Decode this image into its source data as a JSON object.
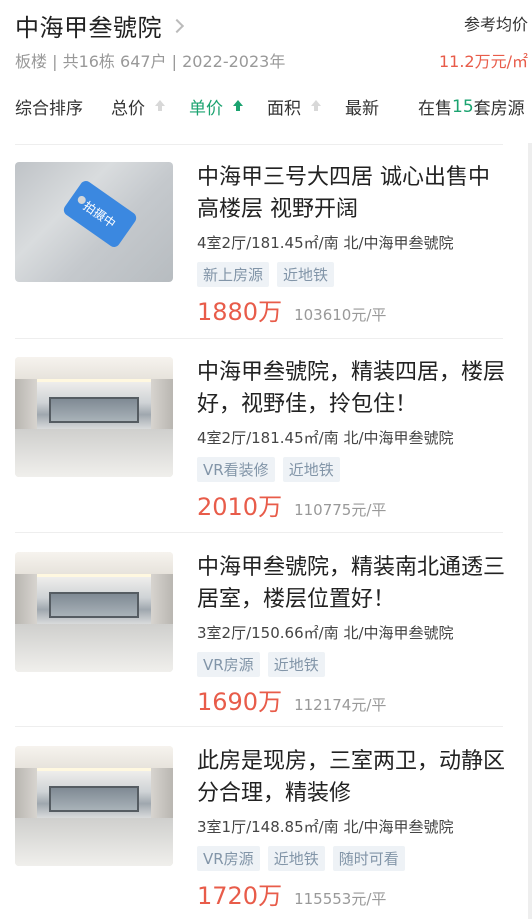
{
  "header": {
    "title": "中海甲叁號院",
    "meta": "板楼 | 共16栋 647户 | 2022-2023年",
    "price_label": "参考均价",
    "price_value": "11.2万元/㎡"
  },
  "sort": {
    "items": [
      "综合排序",
      "总价",
      "单价",
      "面积",
      "最新"
    ],
    "on_sale_prefix": "在售",
    "on_sale_count": "15",
    "on_sale_suffix": "套房源",
    "accent_color": "#1ba370"
  },
  "listings": [
    {
      "title": "中海甲三号大四居 诚心出售中高楼层 视野开阔",
      "info": "4室2厅/181.45㎡/南 北/中海甲叁號院",
      "tags": [
        "新上房源",
        "近地铁"
      ],
      "total": "1880万",
      "unit_price": "103610元/平",
      "image_badge": "拍摄中"
    },
    {
      "title": "中海甲叁號院，精装四居，楼层好，视野佳，拎包住！",
      "info": "4室2厅/181.45㎡/南 北/中海甲叁號院",
      "tags": [
        "VR看装修",
        "近地铁"
      ],
      "total": "2010万",
      "unit_price": "110775元/平"
    },
    {
      "title": "中海甲叁號院，精装南北通透三居室，楼层位置好！",
      "info": "3室2厅/150.66㎡/南 北/中海甲叁號院",
      "tags": [
        "VR房源",
        "近地铁"
      ],
      "total": "1690万",
      "unit_price": "112174元/平"
    },
    {
      "title": "此房是现房，三室两卫，动静区分合理，精装修",
      "info": "3室1厅/148.85㎡/南 北/中海甲叁號院",
      "tags": [
        "VR房源",
        "近地铁",
        "随时可看"
      ],
      "total": "1720万",
      "unit_price": "115553元/平"
    }
  ],
  "colors": {
    "price_red": "#e85c4a",
    "tag_text": "#8295a8",
    "tag_bg": "#eef2f6"
  }
}
